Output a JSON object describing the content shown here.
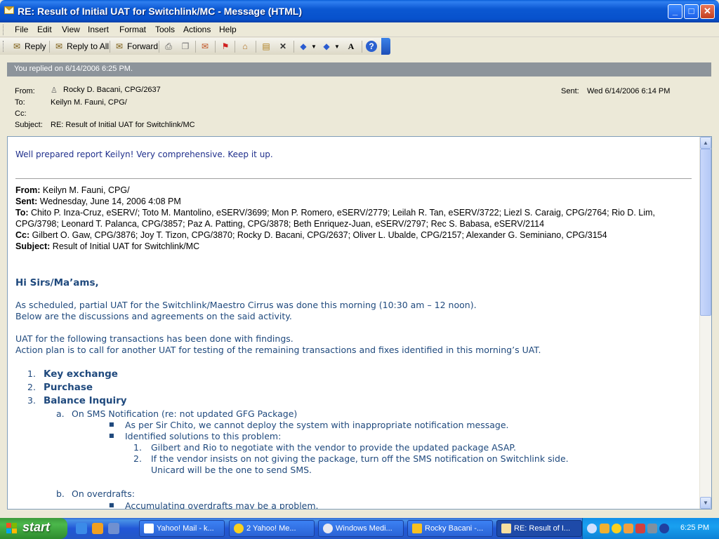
{
  "window": {
    "title": "RE: Result of Initial UAT for Switchlink/MC - Message (HTML)",
    "minimize": "_",
    "maximize": "□",
    "close": "✕"
  },
  "menu": {
    "items": [
      {
        "label": "File"
      },
      {
        "label": "Edit"
      },
      {
        "label": "View"
      },
      {
        "label": "Insert"
      },
      {
        "label": "Format"
      },
      {
        "label": "Tools"
      },
      {
        "label": "Actions"
      },
      {
        "label": "Help"
      }
    ]
  },
  "toolbar": {
    "reply": "Reply",
    "reply_all": "Reply to All",
    "forward": "Forward",
    "icons": [
      "print-icon",
      "copy-icon",
      "move-icon",
      "flag-icon",
      "address-book-icon",
      "move-to-folder-icon",
      "delete-icon",
      "previous-item-icon",
      "next-item-icon",
      "font-size-icon",
      "help-icon"
    ]
  },
  "header": {
    "replied_info": "You replied on 6/14/2006 6:25 PM.",
    "from_label": "From:",
    "from_value": "Rocky D. Bacani, CPG/2637",
    "to_label": "To:",
    "to_value": "Keilyn M. Fauni, CPG/",
    "cc_label": "Cc:",
    "cc_value": "",
    "subject_label": "Subject:",
    "subject_value": "RE: Result of Initial UAT for Switchlink/MC",
    "sent_label": "Sent:",
    "sent_value": "Wed 6/14/2006 6:14 PM"
  },
  "body": {
    "reply_text": "Well prepared report Keilyn! Very comprehensive. Keep it up.",
    "fwd_from_label": "From:",
    "fwd_from": "Keilyn M. Fauni, CPG/",
    "fwd_sent_label": "Sent:",
    "fwd_sent": "Wednesday, June 14, 2006 4:08 PM",
    "fwd_to_label": "To:",
    "fwd_to_line1": "Chito P. Inza-Cruz, eSERV/; Toto M. Mantolino, eSERV/3699; Mon P. Romero, eSERV/2779; Leilah R. Tan, eSERV/3722; Liezl S. Caraig, CPG/2764; Rio D. Lim,",
    "fwd_to_line2": "CPG/3798; Leonard T. Palanca, CPG/3857; Paz A. Patting, CPG/3878; Beth Enriquez-Juan, eSERV/2797; Rec S. Babasa, eSERV/2114",
    "fwd_cc_label": "Cc:",
    "fwd_cc": "Gilbert O. Gaw, CPG/3876; Joy T. Tizon, CPG/3870; Rocky D. Bacani, CPG/2637; Oliver L. Ubalde, CPG/2157; Alexander G. Seminiano, CPG/3154",
    "fwd_subject_label": "Subject:",
    "fwd_subject": "Result of Initial UAT for Switchlink/MC",
    "greeting": "Hi Sirs/Ma’ams,",
    "para1_line1": "As scheduled, partial UAT for the Switchlink/Maestro Cirrus was done this morning (10:30 am – 12 noon).",
    "para1_line2": "Below are the discussions and agreements on the said activity.",
    "para2_line1": "UAT for the following transactions has been done with findings.",
    "para2_line2": "Action plan is to call for another UAT for testing of the remaining transactions and fixes identified in this morning’s UAT.",
    "list": [
      {
        "num": "1.",
        "label": "Key exchange"
      },
      {
        "num": "2.",
        "label": "Purchase"
      },
      {
        "num": "3.",
        "label": "Balance Inquiry"
      }
    ],
    "sub_a_marker": "a.",
    "sub_a": "On SMS Notification (re: not updated GFG Package)",
    "bullet1": "As per Sir Chito, we cannot deploy the system with inappropriate notification message.",
    "bullet2": "Identified solutions to this problem:",
    "sol1_num": "1.",
    "sol1": "Gilbert and Rio to negotiate with the vendor to provide the updated package ASAP.",
    "sol2_num": "2.",
    "sol2_line1": "If the vendor insists on not giving the package, turn off the SMS notification on Switchlink side.",
    "sol2_line2": "Unicard will be the one to send SMS.",
    "sub_b_marker": "b.",
    "sub_b": "On overdrafts:",
    "bullet3": "Accumulating overdrafts may be a problem."
  },
  "taskbar": {
    "start": "start",
    "tasks": [
      {
        "label": "Yahoo! Mail - k..."
      },
      {
        "label": "2 Yahoo! Me..."
      },
      {
        "label": "Windows Medi..."
      },
      {
        "label": "Rocky Bacani -..."
      },
      {
        "label": "RE: Result of I..."
      }
    ],
    "clock": "6:25 PM"
  }
}
